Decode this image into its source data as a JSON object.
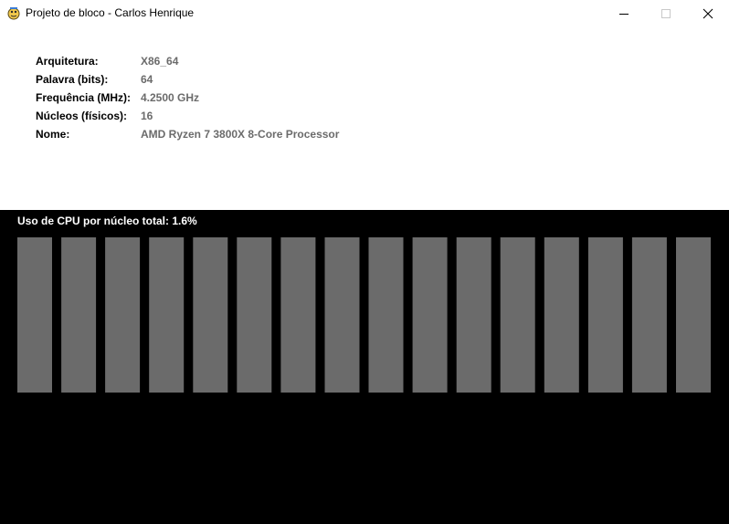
{
  "window": {
    "title": "Projeto de bloco - Carlos Henrique",
    "controls": [
      "minimize",
      "maximize",
      "close"
    ]
  },
  "info": {
    "rows": [
      {
        "label": "Arquitetura:",
        "value": "X86_64"
      },
      {
        "label": "Palavra (bits):",
        "value": "64"
      },
      {
        "label": "Frequência (MHz):",
        "value": "4.2500 GHz"
      },
      {
        "label": "Núcleos (físicos):",
        "value": "16"
      },
      {
        "label": "Nome:",
        "value": "AMD Ryzen 7 3800X 8-Core Processor"
      }
    ]
  },
  "cpu": {
    "title": "Uso de CPU por núcleo total: 1.6%",
    "core_count": 16,
    "bar_color": "#6b6b6b",
    "background": "#000000"
  }
}
